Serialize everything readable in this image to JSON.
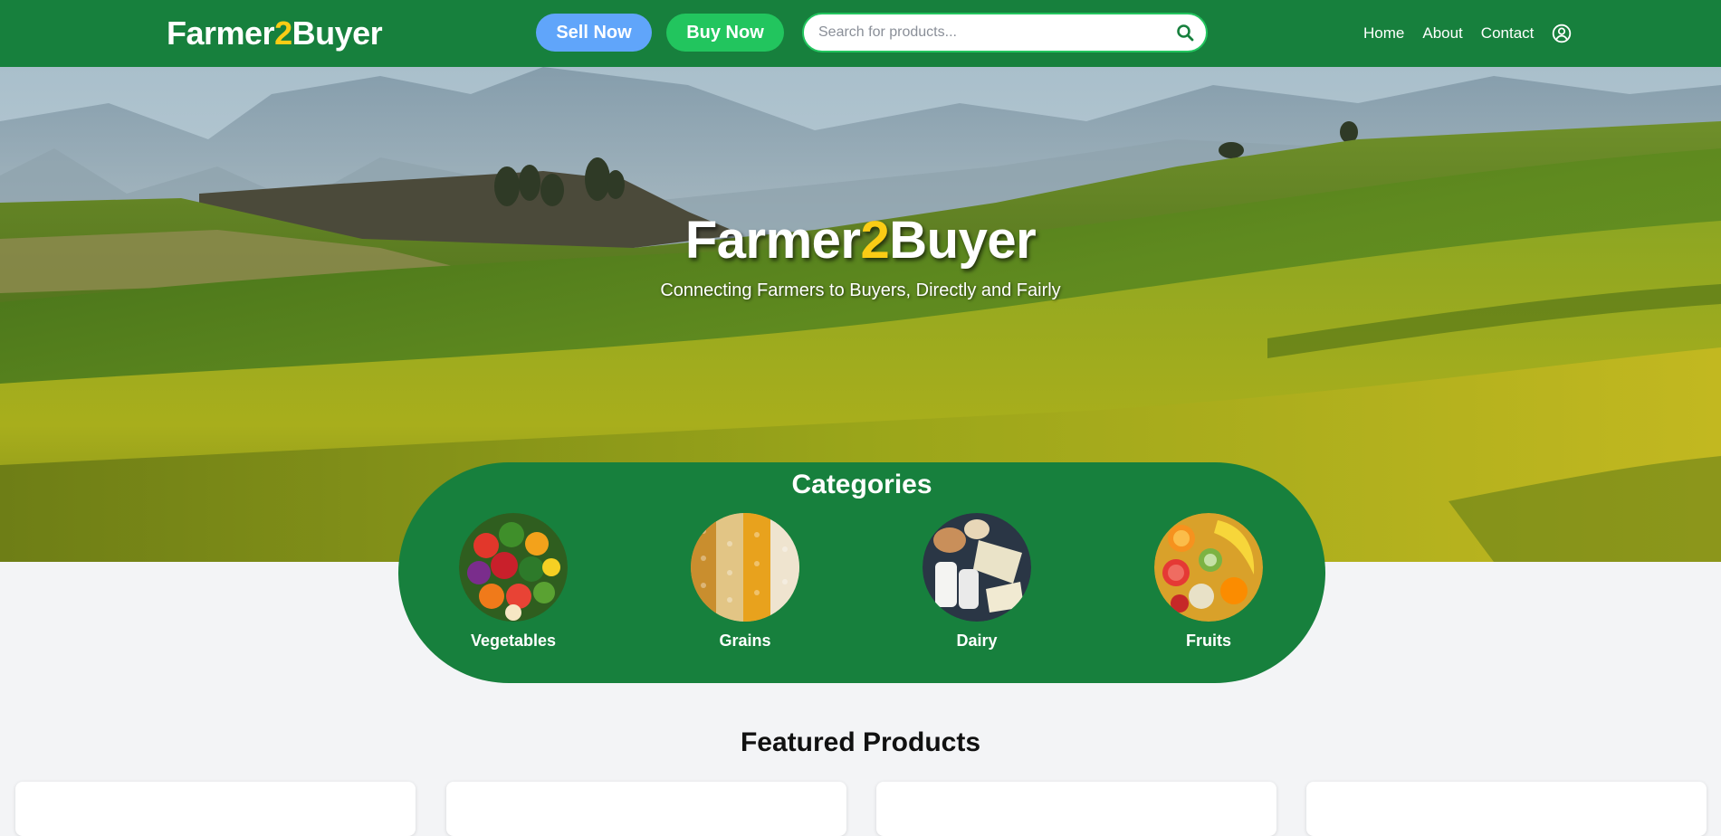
{
  "brand": {
    "prefix": "Farmer",
    "middle": "2",
    "suffix": "Buyer"
  },
  "header": {
    "sell_label": "Sell Now",
    "buy_label": "Buy Now",
    "search_placeholder": "Search for products...",
    "nav": [
      "Home",
      "About",
      "Contact"
    ],
    "icons": {
      "search": "search-icon",
      "user": "user-circle-icon"
    }
  },
  "hero": {
    "subtitle": "Connecting Farmers to Buyers, Directly and Fairly"
  },
  "categories": {
    "title": "Categories",
    "items": [
      {
        "label": "Vegetables"
      },
      {
        "label": "Grains"
      },
      {
        "label": "Dairy"
      },
      {
        "label": "Fruits"
      }
    ]
  },
  "featured": {
    "title": "Featured Products"
  },
  "colors": {
    "primary_green": "#17803d",
    "accent_yellow": "#facc15",
    "sell_button": "#60a5fa",
    "buy_button": "#22c55e",
    "page_background": "#f3f4f6"
  }
}
